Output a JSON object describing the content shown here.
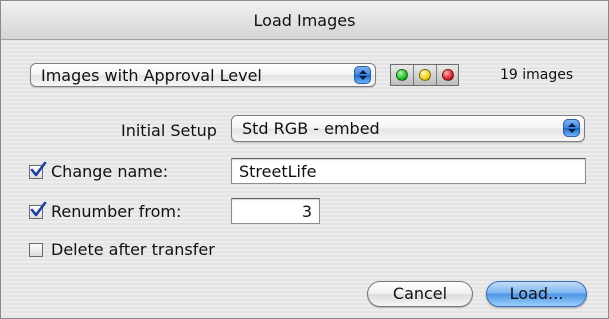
{
  "window": {
    "title": "Load Images"
  },
  "filter": {
    "selected": "Images with Approval Level",
    "color_levels": [
      {
        "name": "green",
        "color": "#1fbf2a"
      },
      {
        "name": "yellow",
        "color": "#f2d21b"
      },
      {
        "name": "red",
        "color": "#e0202a"
      }
    ],
    "image_count": "19 images"
  },
  "initial_setup": {
    "label": "Initial Setup",
    "selected": "Std RGB - embed"
  },
  "change_name": {
    "label": "Change name:",
    "checked": true,
    "value": "StreetLife"
  },
  "renumber": {
    "label": "Renumber from:",
    "checked": true,
    "value": "3"
  },
  "delete_after_transfer": {
    "label": "Delete after transfer",
    "checked": false
  },
  "buttons": {
    "cancel": "Cancel",
    "load": "Load..."
  },
  "colors": {
    "default_button": "#4d95e6",
    "popup_arrows": "#3a82e4",
    "checkmark": "#1a3fa0"
  }
}
